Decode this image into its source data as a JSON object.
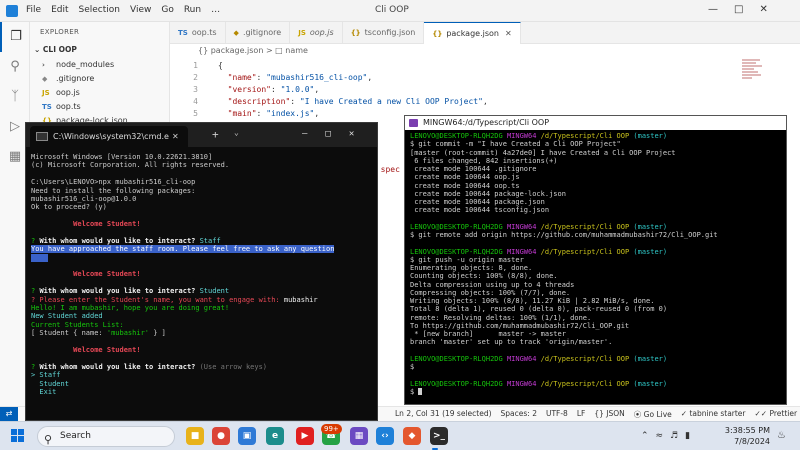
{
  "vscode": {
    "title": "Cli OOP",
    "menu": [
      "File",
      "Edit",
      "Selection",
      "View",
      "Go",
      "Run",
      "…"
    ],
    "explorer_title": "EXPLORER",
    "project": "CLI OOP",
    "tree": [
      {
        "icon": "›",
        "name": "node_modules",
        "color": "#555"
      },
      {
        "icon": "◆",
        "name": ".gitignore",
        "color": "#888"
      },
      {
        "icon": "JS",
        "name": "oop.js",
        "color": "#c9a400"
      },
      {
        "icon": "TS",
        "name": "oop.ts",
        "color": "#3178c6"
      },
      {
        "icon": "{}",
        "name": "package-lock.json",
        "color": "#c9a400"
      }
    ],
    "tabs": [
      {
        "icon": "TS",
        "label": "oop.ts",
        "active": false,
        "italic": false
      },
      {
        "icon": "◆",
        "label": ".gitignore",
        "active": false,
        "italic": false
      },
      {
        "icon": "JS",
        "label": "oop.js",
        "active": false,
        "italic": true
      },
      {
        "icon": "{}",
        "label": "tsconfig.json",
        "active": false,
        "italic": false
      },
      {
        "icon": "{}",
        "label": "package.json",
        "active": true,
        "italic": false
      }
    ],
    "breadcrumb": "{} package.json  >  □ name",
    "code_lines": [
      {
        "n": "1",
        "text": "{"
      },
      {
        "n": "2",
        "key": "\"name\"",
        "val": "\"mubashir516_cli-oop\""
      },
      {
        "n": "3",
        "key": "\"version\"",
        "val": "\"1.0.0\""
      },
      {
        "n": "4",
        "key": "\"description\"",
        "val": "\"I have Created a new Cli OOP Project\""
      },
      {
        "n": "5",
        "key": "\"main\"",
        "val": "\"index.js\""
      }
    ],
    "peek_text": "c spec",
    "status": {
      "position": "Ln 2, Col 31 (19 selected)",
      "spaces": "Spaces: 2",
      "encoding": "UTF-8",
      "eol": "LF",
      "language": "{} JSON",
      "golive": "Go Live",
      "tabnine": "tabnine starter",
      "prettier": "Prettier"
    }
  },
  "cmd": {
    "tab_title": "C:\\Windows\\system32\\cmd.e",
    "lines": [
      {
        "parts": [
          {
            "t": "Microsoft Windows [Version 10.0.22621.3810]",
            "c": ""
          }
        ]
      },
      {
        "parts": [
          {
            "t": "(c) Microsoft Corporation. All rights reserved.",
            "c": ""
          }
        ]
      },
      {
        "parts": [
          {
            "t": "",
            "c": ""
          }
        ]
      },
      {
        "parts": [
          {
            "t": "C:\\Users\\LENOVO>npx mubashir516_cli-oop",
            "c": ""
          }
        ]
      },
      {
        "parts": [
          {
            "t": "Need to install the following packages:",
            "c": ""
          }
        ]
      },
      {
        "parts": [
          {
            "t": "mubashir516_cli-oop@1.0.0",
            "c": ""
          }
        ]
      },
      {
        "parts": [
          {
            "t": "Ok to proceed? (y)",
            "c": ""
          }
        ]
      },
      {
        "parts": [
          {
            "t": "",
            "c": ""
          }
        ]
      },
      {
        "parts": [
          {
            "t": "          Welcome Student!",
            "c": "c-red c-bold"
          }
        ]
      },
      {
        "parts": [
          {
            "t": "",
            "c": ""
          }
        ]
      },
      {
        "parts": [
          {
            "t": "? ",
            "c": "c-green"
          },
          {
            "t": "With whom would you like to interact? ",
            "c": "c-white c-bold"
          },
          {
            "t": "Staff",
            "c": "c-cyan"
          }
        ]
      },
      {
        "parts": [
          {
            "t": "You have approached the staff room. Please feel free to ask any question",
            "c": "cmd-hl"
          }
        ]
      },
      {
        "parts": [
          {
            "t": "    ",
            "c": "cmd-hl"
          }
        ]
      },
      {
        "parts": [
          {
            "t": "",
            "c": ""
          }
        ]
      },
      {
        "parts": [
          {
            "t": "          Welcome Student!",
            "c": "c-red c-bold"
          }
        ]
      },
      {
        "parts": [
          {
            "t": "",
            "c": ""
          }
        ]
      },
      {
        "parts": [
          {
            "t": "? ",
            "c": "c-green"
          },
          {
            "t": "With whom would you like to interact? ",
            "c": "c-white c-bold"
          },
          {
            "t": "Student",
            "c": "c-cyan"
          }
        ]
      },
      {
        "parts": [
          {
            "t": "? Please enter the Student's name, you want to engage with: ",
            "c": "c-red"
          },
          {
            "t": "mubashir",
            "c": "c-white"
          }
        ]
      },
      {
        "parts": [
          {
            "t": "Hello! I am mubashir, hope you are doing great!",
            "c": "c-green"
          }
        ]
      },
      {
        "parts": [
          {
            "t": "New Student added",
            "c": "c-cyan"
          }
        ]
      },
      {
        "parts": [
          {
            "t": "Current Students List:",
            "c": "c-green"
          }
        ]
      },
      {
        "parts": [
          {
            "t": "[ Student { name: ",
            "c": ""
          },
          {
            "t": "'mubashir'",
            "c": "c-green"
          },
          {
            "t": " } ]",
            "c": ""
          }
        ]
      },
      {
        "parts": [
          {
            "t": "",
            "c": ""
          }
        ]
      },
      {
        "parts": [
          {
            "t": "          Welcome Student!",
            "c": "c-red c-bold"
          }
        ]
      },
      {
        "parts": [
          {
            "t": "",
            "c": ""
          }
        ]
      },
      {
        "parts": [
          {
            "t": "? ",
            "c": "c-green"
          },
          {
            "t": "With whom would you like to interact? ",
            "c": "c-white c-bold"
          },
          {
            "t": "(Use arrow keys)",
            "c": "c-gray"
          }
        ]
      },
      {
        "parts": [
          {
            "t": "> Staff",
            "c": "c-cyan"
          }
        ]
      },
      {
        "parts": [
          {
            "t": "  Student",
            "c": "c-cyan"
          }
        ]
      },
      {
        "parts": [
          {
            "t": "  Exit",
            "c": "c-cyan"
          }
        ]
      }
    ]
  },
  "bash": {
    "title": "MINGW64:/d/Typescript/Cli OOP",
    "lines": [
      {
        "parts": [
          {
            "t": "LENOVO@DESKTOP-RLQH2DG ",
            "c": "b-green"
          },
          {
            "t": "MINGW64 ",
            "c": "b-mag"
          },
          {
            "t": "/d/Typescript/Cli OOP",
            "c": "b-yel"
          },
          {
            "t": " (master)",
            "c": "b-cyan"
          }
        ]
      },
      {
        "parts": [
          {
            "t": "$ git commit -m \"I have Created a Cli OOP Project\"",
            "c": ""
          }
        ]
      },
      {
        "parts": [
          {
            "t": "[master (root-commit) 4a27de0] I have Created a Cli OOP Project",
            "c": ""
          }
        ]
      },
      {
        "parts": [
          {
            "t": " 6 files changed, 842 insertions(+)",
            "c": ""
          }
        ]
      },
      {
        "parts": [
          {
            "t": " create mode 100644 .gitignore",
            "c": ""
          }
        ]
      },
      {
        "parts": [
          {
            "t": " create mode 100644 oop.js",
            "c": ""
          }
        ]
      },
      {
        "parts": [
          {
            "t": " create mode 100644 oop.ts",
            "c": ""
          }
        ]
      },
      {
        "parts": [
          {
            "t": " create mode 100644 package-lock.json",
            "c": ""
          }
        ]
      },
      {
        "parts": [
          {
            "t": " create mode 100644 package.json",
            "c": ""
          }
        ]
      },
      {
        "parts": [
          {
            "t": " create mode 100644 tsconfig.json",
            "c": ""
          }
        ]
      },
      {
        "parts": [
          {
            "t": "",
            "c": ""
          }
        ]
      },
      {
        "parts": [
          {
            "t": "LENOVO@DESKTOP-RLQH2DG ",
            "c": "b-green"
          },
          {
            "t": "MINGW64 ",
            "c": "b-mag"
          },
          {
            "t": "/d/Typescript/Cli OOP",
            "c": "b-yel"
          },
          {
            "t": " (master)",
            "c": "b-cyan"
          }
        ]
      },
      {
        "parts": [
          {
            "t": "$ git remote add origin https://github.com/muhammadmubashir72/Cli_OOP.git",
            "c": ""
          }
        ]
      },
      {
        "parts": [
          {
            "t": "",
            "c": ""
          }
        ]
      },
      {
        "parts": [
          {
            "t": "LENOVO@DESKTOP-RLQH2DG ",
            "c": "b-green"
          },
          {
            "t": "MINGW64 ",
            "c": "b-mag"
          },
          {
            "t": "/d/Typescript/Cli OOP",
            "c": "b-yel"
          },
          {
            "t": " (master)",
            "c": "b-cyan"
          }
        ]
      },
      {
        "parts": [
          {
            "t": "$ git push -u origin master",
            "c": ""
          }
        ]
      },
      {
        "parts": [
          {
            "t": "Enumerating objects: 8, done.",
            "c": ""
          }
        ]
      },
      {
        "parts": [
          {
            "t": "Counting objects: 100% (8/8), done.",
            "c": ""
          }
        ]
      },
      {
        "parts": [
          {
            "t": "Delta compression using up to 4 threads",
            "c": ""
          }
        ]
      },
      {
        "parts": [
          {
            "t": "Compressing objects: 100% (7/7), done.",
            "c": ""
          }
        ]
      },
      {
        "parts": [
          {
            "t": "Writing objects: 100% (8/8), 11.27 KiB | 2.82 MiB/s, done.",
            "c": ""
          }
        ]
      },
      {
        "parts": [
          {
            "t": "Total 8 (delta 1), reused 0 (delta 0), pack-reused 0 (from 0)",
            "c": ""
          }
        ]
      },
      {
        "parts": [
          {
            "t": "remote: Resolving deltas: 100% (1/1), done.",
            "c": ""
          }
        ]
      },
      {
        "parts": [
          {
            "t": "To https://github.com/muhammadmubashir72/Cli_OOP.git",
            "c": ""
          }
        ]
      },
      {
        "parts": [
          {
            "t": " * [new branch]      master -> master",
            "c": ""
          }
        ]
      },
      {
        "parts": [
          {
            "t": "branch 'master' set up to track 'origin/master'.",
            "c": ""
          }
        ]
      },
      {
        "parts": [
          {
            "t": "",
            "c": ""
          }
        ]
      },
      {
        "parts": [
          {
            "t": "LENOVO@DESKTOP-RLQH2DG ",
            "c": "b-green"
          },
          {
            "t": "MINGW64 ",
            "c": "b-mag"
          },
          {
            "t": "/d/Typescript/Cli OOP",
            "c": "b-yel"
          },
          {
            "t": " (master)",
            "c": "b-cyan"
          }
        ]
      },
      {
        "parts": [
          {
            "t": "$",
            "c": ""
          }
        ]
      },
      {
        "parts": [
          {
            "t": "",
            "c": ""
          }
        ]
      },
      {
        "parts": [
          {
            "t": "LENOVO@DESKTOP-RLQH2DG ",
            "c": "b-green"
          },
          {
            "t": "MINGW64 ",
            "c": "b-mag"
          },
          {
            "t": "/d/Typescript/Cli OOP",
            "c": "b-yel"
          },
          {
            "t": " (master)",
            "c": "b-cyan"
          }
        ]
      },
      {
        "parts": [
          {
            "t": "$ ",
            "c": ""
          },
          {
            "cursor": true
          }
        ]
      }
    ]
  },
  "taskbar": {
    "search_label": "Search",
    "badge": "99+",
    "time": "3:38:55 PM",
    "date": "7/8/2024",
    "apps": [
      {
        "name": "file-explorer-app",
        "color": "#e8b21a",
        "glyph": "■"
      },
      {
        "name": "chrome-app",
        "color": "#db4437",
        "glyph": "●"
      },
      {
        "name": "photos-app",
        "color": "#2f7ad6",
        "glyph": "▣"
      },
      {
        "name": "edge-app",
        "color": "#1c8d8c",
        "glyph": "e"
      },
      {
        "name": "youtube-app",
        "color": "#e02020",
        "glyph": "▶"
      },
      {
        "name": "whatsapp-app",
        "color": "#25a244",
        "glyph": "☎"
      },
      {
        "name": "store-app",
        "color": "#6b4ac2",
        "glyph": "▦"
      },
      {
        "name": "vscode-app",
        "color": "#1e80d8",
        "glyph": "‹›"
      },
      {
        "name": "git-app",
        "color": "#e4572e",
        "glyph": "◆"
      },
      {
        "name": "terminal-app",
        "color": "#2b2b2b",
        "glyph": ">_"
      }
    ]
  }
}
